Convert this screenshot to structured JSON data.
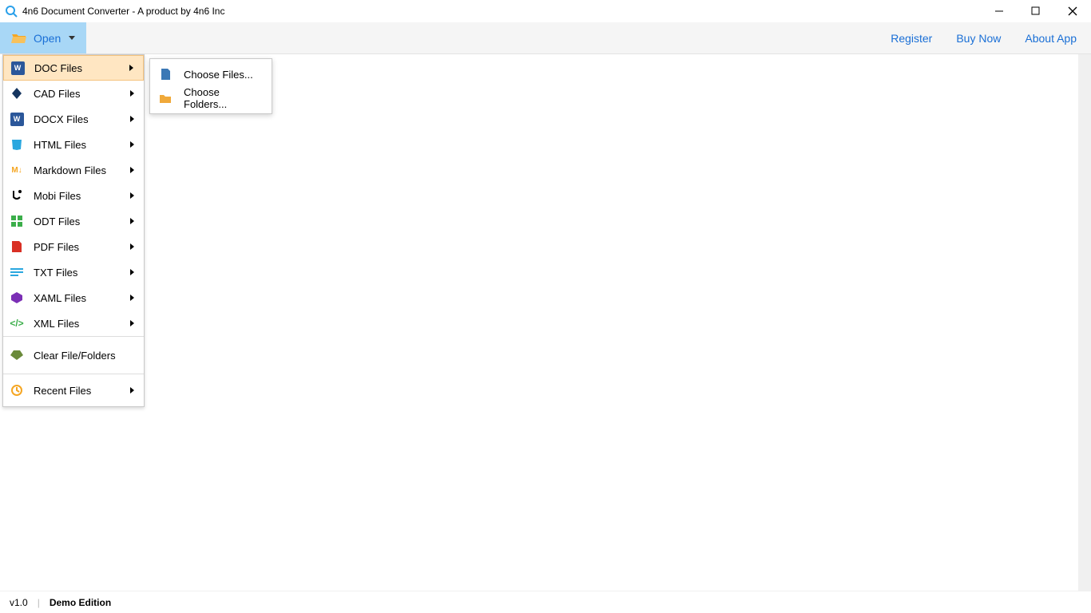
{
  "titlebar": {
    "title": "4n6 Document Converter - A product by 4n6 Inc"
  },
  "toolbar": {
    "open_label": "Open",
    "links": {
      "register": "Register",
      "buy": "Buy Now",
      "about": "About App"
    }
  },
  "menu": {
    "items": [
      {
        "label": "DOC Files"
      },
      {
        "label": "CAD Files"
      },
      {
        "label": "DOCX Files"
      },
      {
        "label": "HTML Files"
      },
      {
        "label": "Markdown Files"
      },
      {
        "label": "Mobi Files"
      },
      {
        "label": "ODT Files"
      },
      {
        "label": "PDF Files"
      },
      {
        "label": "TXT Files"
      },
      {
        "label": "XAML Files"
      },
      {
        "label": "XML Files"
      }
    ],
    "clear_label": "Clear File/Folders",
    "recent_label": "Recent Files"
  },
  "submenu": {
    "choose_files": "Choose Files...",
    "choose_folders": "Choose Folders..."
  },
  "statusbar": {
    "version": "v1.0",
    "edition": "Demo Edition"
  }
}
